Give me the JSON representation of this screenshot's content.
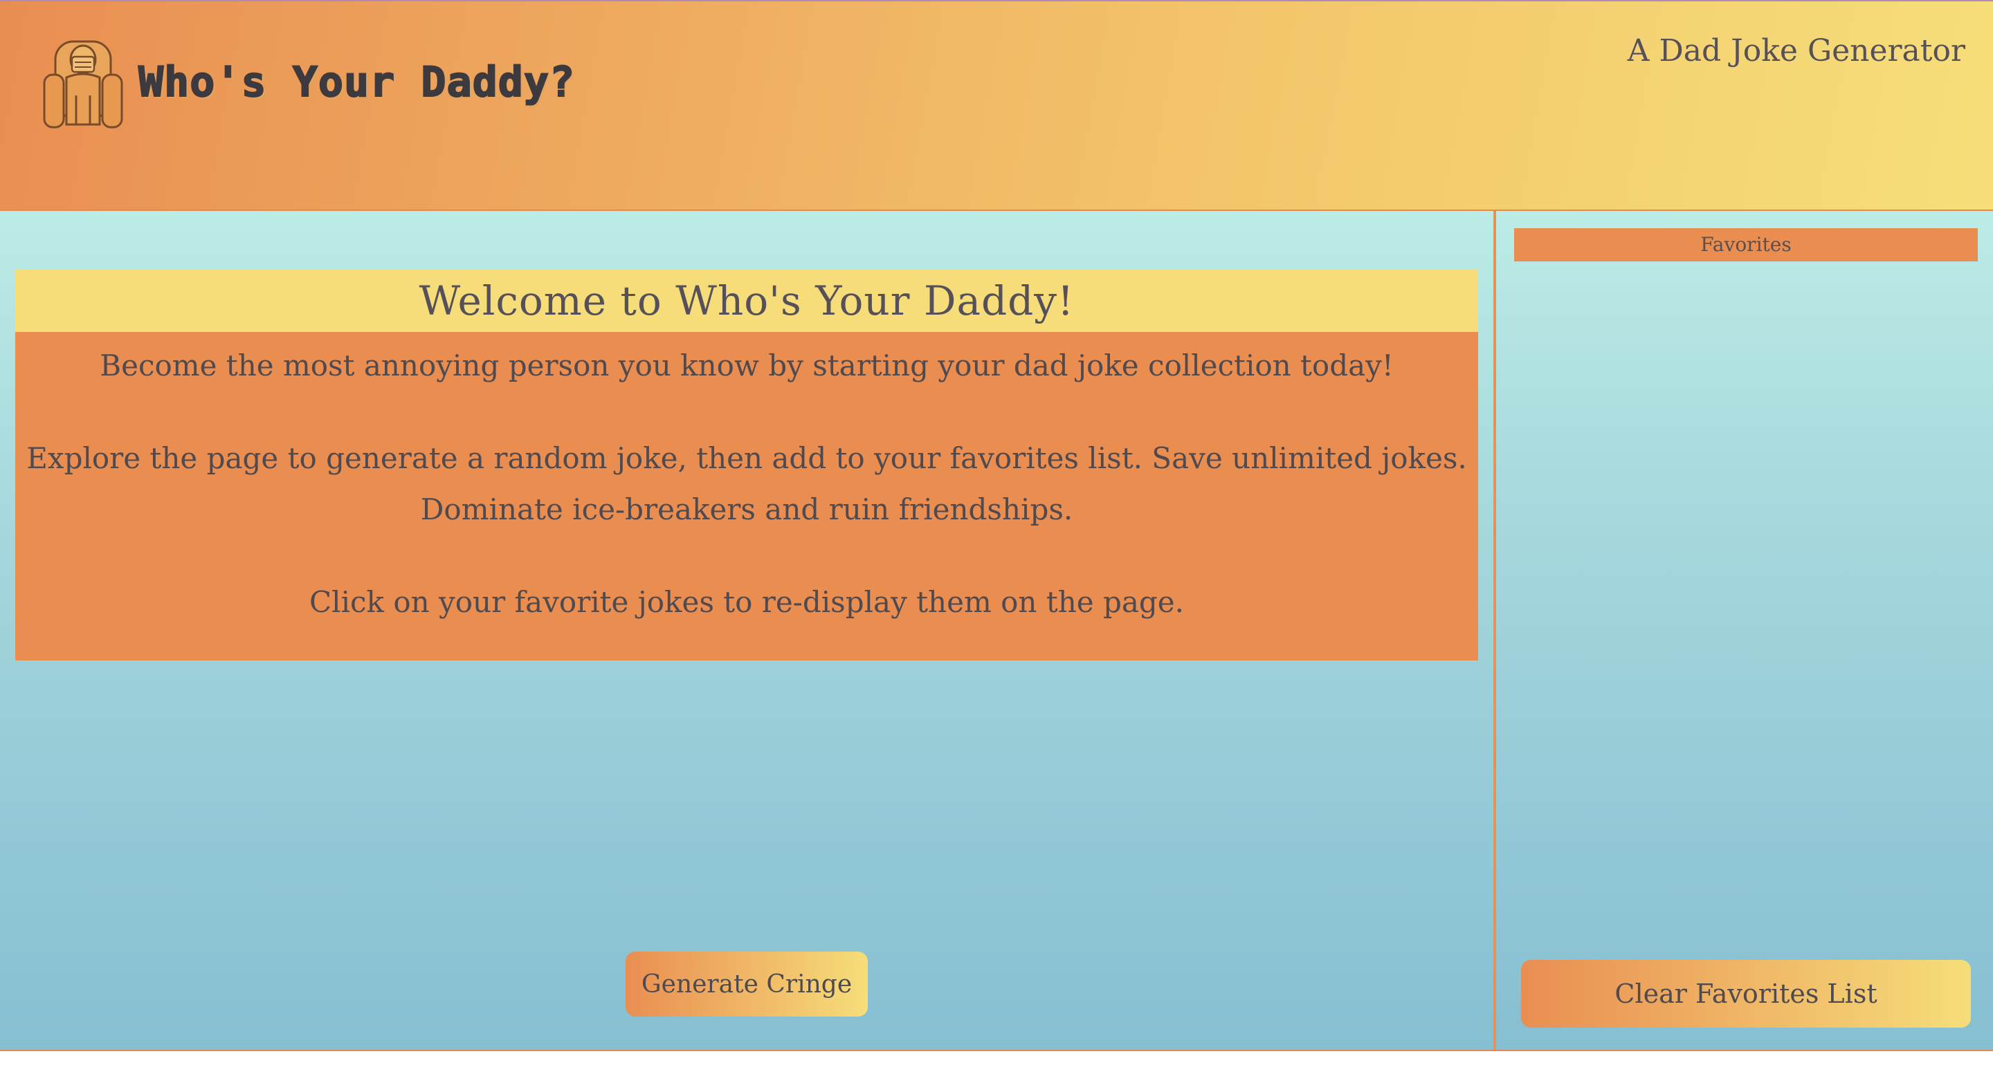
{
  "header": {
    "title": "Who's Your Daddy?",
    "tagline": "A Dad Joke Generator",
    "logo_icon": "armchair-dad-icon"
  },
  "welcome": {
    "title": "Welcome to Who's Your Daddy!",
    "line1": "Become the most annoying person you know by starting your dad joke collection today!",
    "line2": "Explore the page to generate a random joke, then add to your favorites list. Save unlimited jokes.",
    "line3": "Dominate ice-breakers and ruin friendships.",
    "line4": "Click on your favorite jokes to re-display them on the page."
  },
  "actions": {
    "generate_label": "Generate Cringe",
    "clear_label": "Clear Favorites List"
  },
  "favorites": {
    "header": "Favorites",
    "items": []
  },
  "colors": {
    "orange": "#e98d50",
    "yellow": "#f6dd7a",
    "teal_top": "#bcece6",
    "teal_bottom": "#86bfd2"
  }
}
